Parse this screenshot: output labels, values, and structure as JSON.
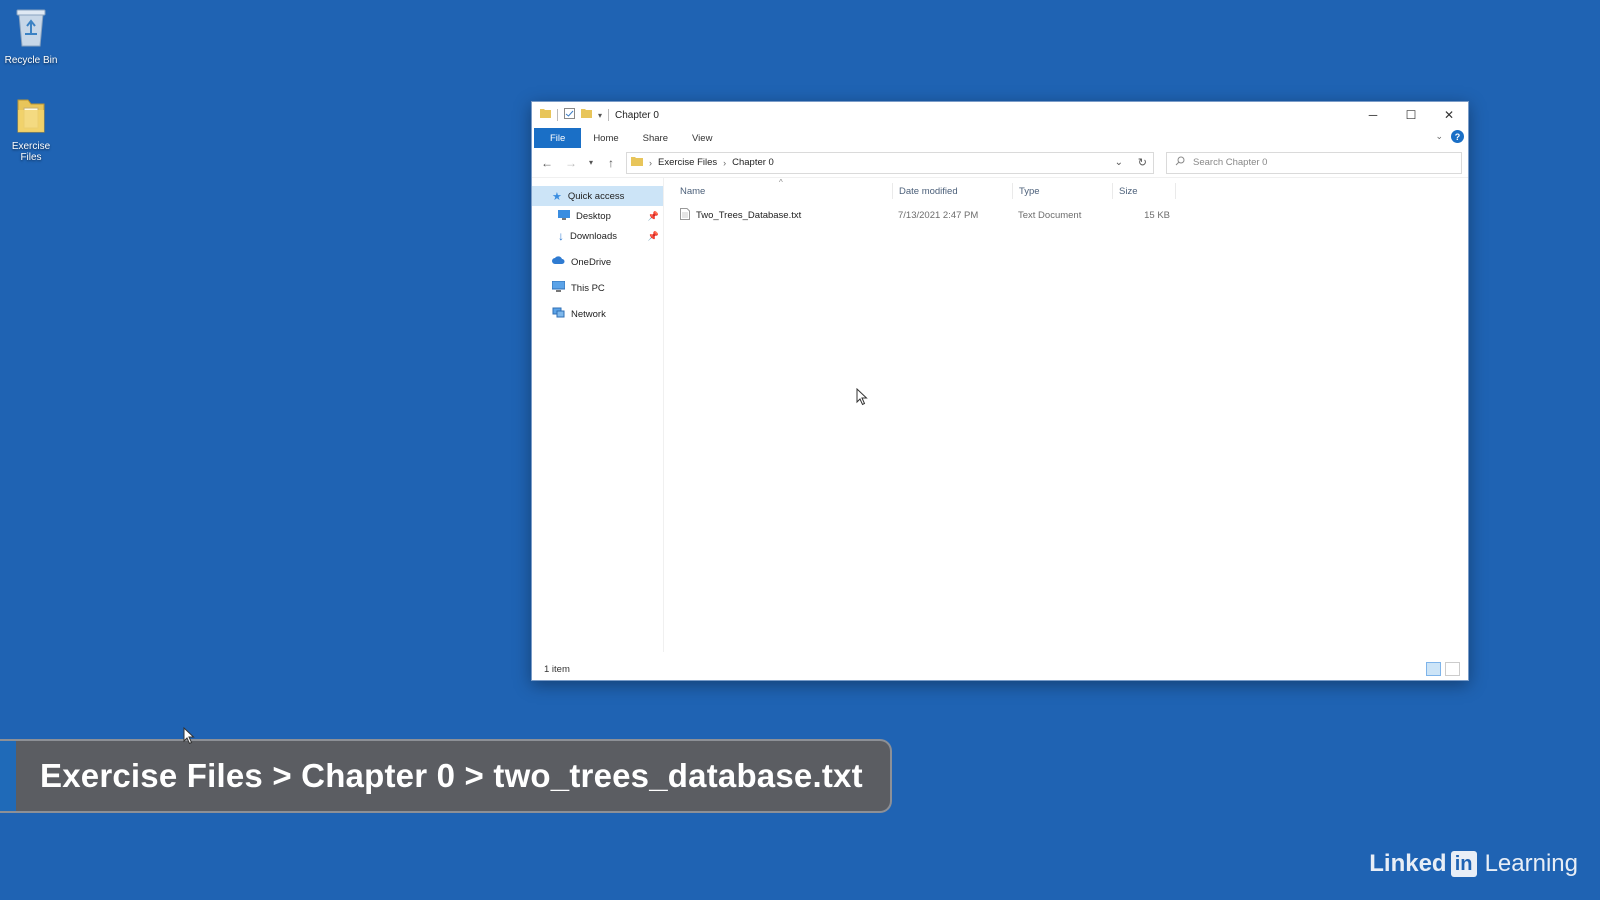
{
  "desktop": {
    "icons": [
      {
        "label": "Recycle Bin"
      },
      {
        "label": "Exercise Files"
      }
    ]
  },
  "window": {
    "title": "Chapter 0",
    "ribbon_tabs": [
      "File",
      "Home",
      "Share",
      "View"
    ],
    "address": {
      "crumbs": [
        "Exercise Files",
        "Chapter 0"
      ]
    },
    "search": {
      "placeholder": "Search Chapter 0"
    },
    "nav_pane": {
      "quick_access": "Quick access",
      "desktop": "Desktop",
      "downloads": "Downloads",
      "onedrive": "OneDrive",
      "this_pc": "This PC",
      "network": "Network"
    },
    "columns": {
      "name": "Name",
      "date": "Date modified",
      "type": "Type",
      "size": "Size"
    },
    "files": [
      {
        "name": "Two_Trees_Database.txt",
        "date": "7/13/2021 2:47 PM",
        "type": "Text Document",
        "size": "15 KB"
      }
    ],
    "status": "1 item"
  },
  "lower_third": {
    "text": "Exercise Files > Chapter 0 > two_trees_database.txt"
  },
  "brand": {
    "linked": "Linked",
    "in": "in",
    "learning": "Learning"
  },
  "colors": {
    "desktop_bg": "#1f63b3",
    "accent": "#1a6fc6",
    "selection": "#cce4f7"
  }
}
